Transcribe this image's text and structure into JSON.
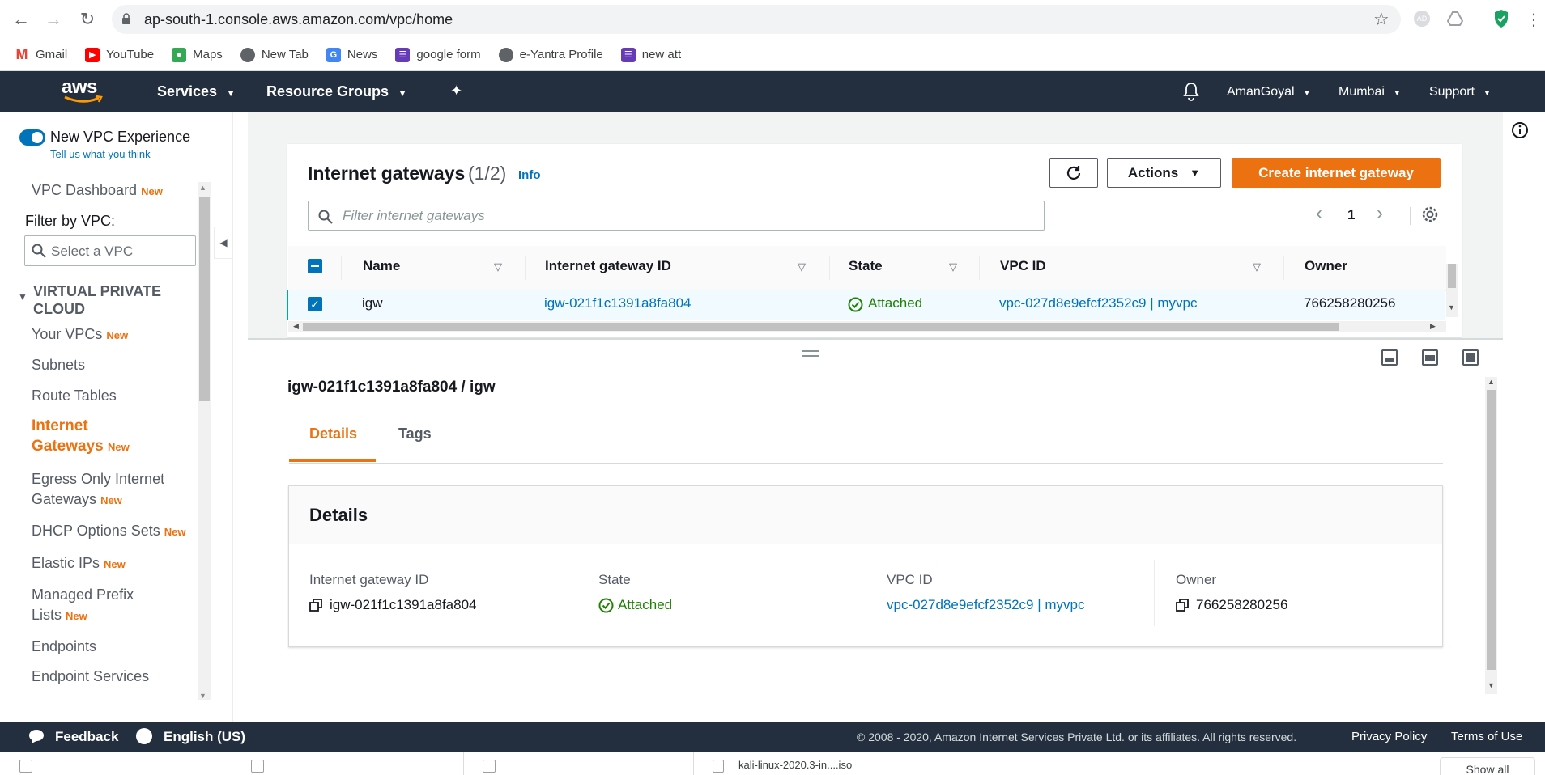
{
  "browser": {
    "url": "ap-south-1.console.aws.amazon.com/vpc/home",
    "bookmarks": [
      {
        "label": "Gmail",
        "icon": "gmail-icon",
        "color": "#ea4335"
      },
      {
        "label": "YouTube",
        "icon": "youtube-icon",
        "color": "#ff0000"
      },
      {
        "label": "Maps",
        "icon": "maps-icon",
        "color": "#34a853"
      },
      {
        "label": "New Tab",
        "icon": "globe-icon",
        "color": "#5f6368"
      },
      {
        "label": "News",
        "icon": "news-icon",
        "color": "#4285f4"
      },
      {
        "label": "google form",
        "icon": "forms-icon",
        "color": "#673ab7"
      },
      {
        "label": "e-Yantra Profile",
        "icon": "globe-icon",
        "color": "#5f6368"
      },
      {
        "label": "new att",
        "icon": "forms-icon",
        "color": "#673ab7"
      }
    ],
    "profile_initials": "AD"
  },
  "aws_header": {
    "logo": "aws",
    "services": "Services",
    "resource_groups": "Resource Groups",
    "user": "AmanGoyal",
    "region": "Mumbai",
    "support": "Support"
  },
  "sidebar": {
    "toggle_label": "New VPC Experience",
    "toggle_sub": "Tell us what you think",
    "dashboard": "VPC Dashboard",
    "new_badge": "New",
    "filter_label": "Filter by VPC:",
    "filter_placeholder": "Select a VPC",
    "section_title": "VIRTUAL PRIVATE CLOUD",
    "items": [
      {
        "label": "Your VPCs",
        "new": true
      },
      {
        "label": "Subnets",
        "new": false
      },
      {
        "label": "Route Tables",
        "new": false
      },
      {
        "label": "Internet Gateways",
        "new": true,
        "active": true
      },
      {
        "label": "Egress Only Internet Gateways",
        "new": true
      },
      {
        "label": "DHCP Options Sets",
        "new": true
      },
      {
        "label": "Elastic IPs",
        "new": true
      },
      {
        "label": "Managed Prefix Lists",
        "new": true
      },
      {
        "label": "Endpoints",
        "new": false
      },
      {
        "label": "Endpoint Services",
        "new": false
      }
    ]
  },
  "list": {
    "title": "Internet gateways",
    "count": "(1/2)",
    "info": "Info",
    "actions": "Actions",
    "create": "Create internet gateway",
    "filter_placeholder": "Filter internet gateways",
    "page": "1",
    "columns": [
      "Name",
      "Internet gateway ID",
      "State",
      "VPC ID",
      "Owner"
    ],
    "rows": [
      {
        "name": "igw",
        "id": "igw-021f1c1391a8fa804",
        "state": "Attached",
        "vpc": "vpc-027d8e9efcf2352c9 | myvpc",
        "owner": "766258280256"
      }
    ]
  },
  "detail": {
    "heading": "igw-021f1c1391a8fa804 / igw",
    "tabs": [
      "Details",
      "Tags"
    ],
    "card_title": "Details",
    "fields": [
      {
        "label": "Internet gateway ID",
        "value": "igw-021f1c1391a8fa804"
      },
      {
        "label": "State",
        "value": "Attached"
      },
      {
        "label": "VPC ID",
        "value": "vpc-027d8e9efcf2352c9 | myvpc"
      },
      {
        "label": "Owner",
        "value": "766258280256"
      }
    ]
  },
  "footer": {
    "feedback": "Feedback",
    "language": "English (US)",
    "copyright": "© 2008 - 2020, Amazon Internet Services Private Ltd. or its affiliates. All rights reserved.",
    "privacy": "Privacy Policy",
    "terms": "Terms of Use"
  },
  "downloads": {
    "items": [
      "",
      "",
      "",
      "kali-linux-2020.3-in....iso"
    ],
    "show_all": "Show all"
  },
  "colors": {
    "aws_nav": "#232f3e",
    "accent_orange": "#ec7211",
    "link_blue": "#0073bb",
    "success_green": "#1d8102"
  }
}
